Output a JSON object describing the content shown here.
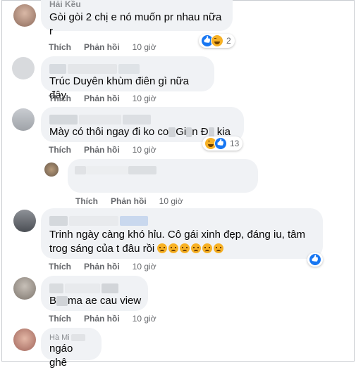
{
  "actions": {
    "like": "Thích",
    "reply": "Phản hồi"
  },
  "comments": [
    {
      "name": "Hải Kều",
      "text": "Gòi gòi 2 chị e nó muốn pr nhau nữa r",
      "time": "10 giờ",
      "reactions": [
        "like-icon",
        "haha-icon"
      ],
      "reaction_count": "2"
    },
    {
      "name": "",
      "text": "Trúc Duyên khùm điên gì nữa đây",
      "time": "10 giờ"
    },
    {
      "name": "",
      "text_a": "Mày có thôi ngay đi ko co",
      "text_b": "Gi",
      "text_c": "n Đ",
      "text_d": "kia",
      "time": "10 giờ",
      "reactions": [
        "haha-icon",
        "like-icon"
      ],
      "reaction_count": "13"
    },
    {
      "name": "",
      "text": "",
      "time": "10 giờ"
    },
    {
      "name": "",
      "text": "Trinh ngày càng khó hỉu. Cô gái xinh đẹp, đáng iu, tâm trog sáng của t đâu rồi",
      "time": "10 giờ",
      "reactions": [
        "like-icon"
      ]
    },
    {
      "name": "",
      "text_a": "B",
      "text_b": "ma ae cau view",
      "time": "10 giờ"
    },
    {
      "name": "Hà Mi",
      "text": "ngáo ghê"
    }
  ],
  "colors": {
    "bubble": "#f0f2f5",
    "muted": "#65676b",
    "like": "#1877f2",
    "emoji": "#f7b125"
  }
}
